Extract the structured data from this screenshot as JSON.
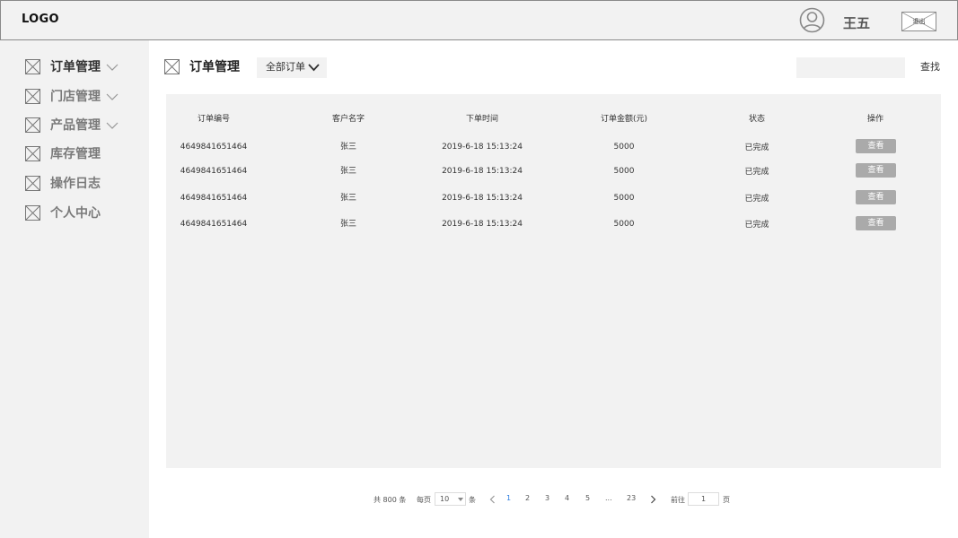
{
  "header": {
    "logo": "LOGO",
    "user_icon": "user-circle-icon",
    "username": "王五",
    "logout_label": "退出"
  },
  "sidebar": {
    "items": [
      {
        "label": "订单管理",
        "icon": "placeholder-image-icon",
        "expandable": true,
        "active": true
      },
      {
        "label": "门店管理",
        "icon": "placeholder-image-icon",
        "expandable": true
      },
      {
        "label": "产品管理",
        "icon": "placeholder-image-icon",
        "expandable": true
      },
      {
        "label": "库存管理",
        "icon": "placeholder-image-icon",
        "expandable": false
      },
      {
        "label": "操作日志",
        "icon": "placeholder-image-icon",
        "expandable": false
      },
      {
        "label": "个人中心",
        "icon": "placeholder-image-icon",
        "expandable": false
      }
    ]
  },
  "main": {
    "title": "订单管理",
    "filter": {
      "selected": "全部订单"
    },
    "search": {
      "value": "",
      "placeholder": "",
      "button_label": "查找"
    },
    "table": {
      "columns": [
        "订单编号",
        "客户名字",
        "下单时间",
        "订单金额(元)",
        "状态",
        "操作"
      ],
      "rows": [
        {
          "order_id": "4649841651464",
          "customer": "张三",
          "time": "2019-6-18 15:13:24",
          "amount": "5000",
          "status": "已完成",
          "action": "查看"
        },
        {
          "order_id": "4649841651464",
          "customer": "张三",
          "time": "2019-6-18 15:13:24",
          "amount": "5000",
          "status": "已完成",
          "action": "查看"
        },
        {
          "order_id": "4649841651464",
          "customer": "张三",
          "time": "2019-6-18 15:13:24",
          "amount": "5000",
          "status": "已完成",
          "action": "查看"
        },
        {
          "order_id": "4649841651464",
          "customer": "张三",
          "time": "2019-6-18 15:13:24",
          "amount": "5000",
          "status": "已完成",
          "action": "查看"
        }
      ]
    },
    "pagination": {
      "total_text": "共 800 条",
      "per_page_label": "每页",
      "per_page_value": "10",
      "per_page_unit": "条",
      "pages": [
        "1",
        "2",
        "3",
        "4",
        "5",
        "...",
        "23"
      ],
      "current_page": "1",
      "goto_label": "前往",
      "goto_value": "1",
      "goto_unit": "页"
    }
  },
  "colors": {
    "panel_bg": "#f2f2f2",
    "button_gray": "#aaaaaa",
    "current_page": "#2b7de1"
  }
}
